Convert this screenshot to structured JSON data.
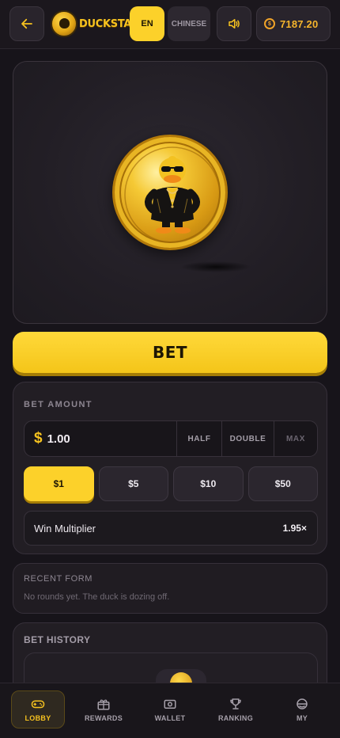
{
  "header": {
    "logo_text": "DUCKSTAKE",
    "lang_active": "EN",
    "lang_other": "CHINESE",
    "balance": "7187.20"
  },
  "game": {
    "bet_label": "BET"
  },
  "bet_panel": {
    "label": "BET AMOUNT",
    "currency_symbol": "$",
    "amount": "1.00",
    "half_label": "HALF",
    "double_label": "DOUBLE",
    "max_label": "MAX",
    "chips": [
      "$1",
      "$5",
      "$10",
      "$50"
    ],
    "selected_chip": "$1",
    "multiplier_label": "Win Multiplier",
    "multiplier_value": "1.95×"
  },
  "recent_form": {
    "title": "RECENT FORM",
    "empty_text": "No rounds yet. The duck is dozing off."
  },
  "history": {
    "title": "BET HISTORY"
  },
  "nav": {
    "items": [
      {
        "label": "LOBBY",
        "icon": "gamepad-icon"
      },
      {
        "label": "REWARDS",
        "icon": "gift-icon"
      },
      {
        "label": "WALLET",
        "icon": "wallet-icon"
      },
      {
        "label": "RANKING",
        "icon": "trophy-icon"
      },
      {
        "label": "MY",
        "icon": "user-icon"
      }
    ],
    "active": "LOBBY"
  },
  "colors": {
    "accent": "#fcd12a",
    "balance": "#f6b52c",
    "background": "#17141a"
  }
}
